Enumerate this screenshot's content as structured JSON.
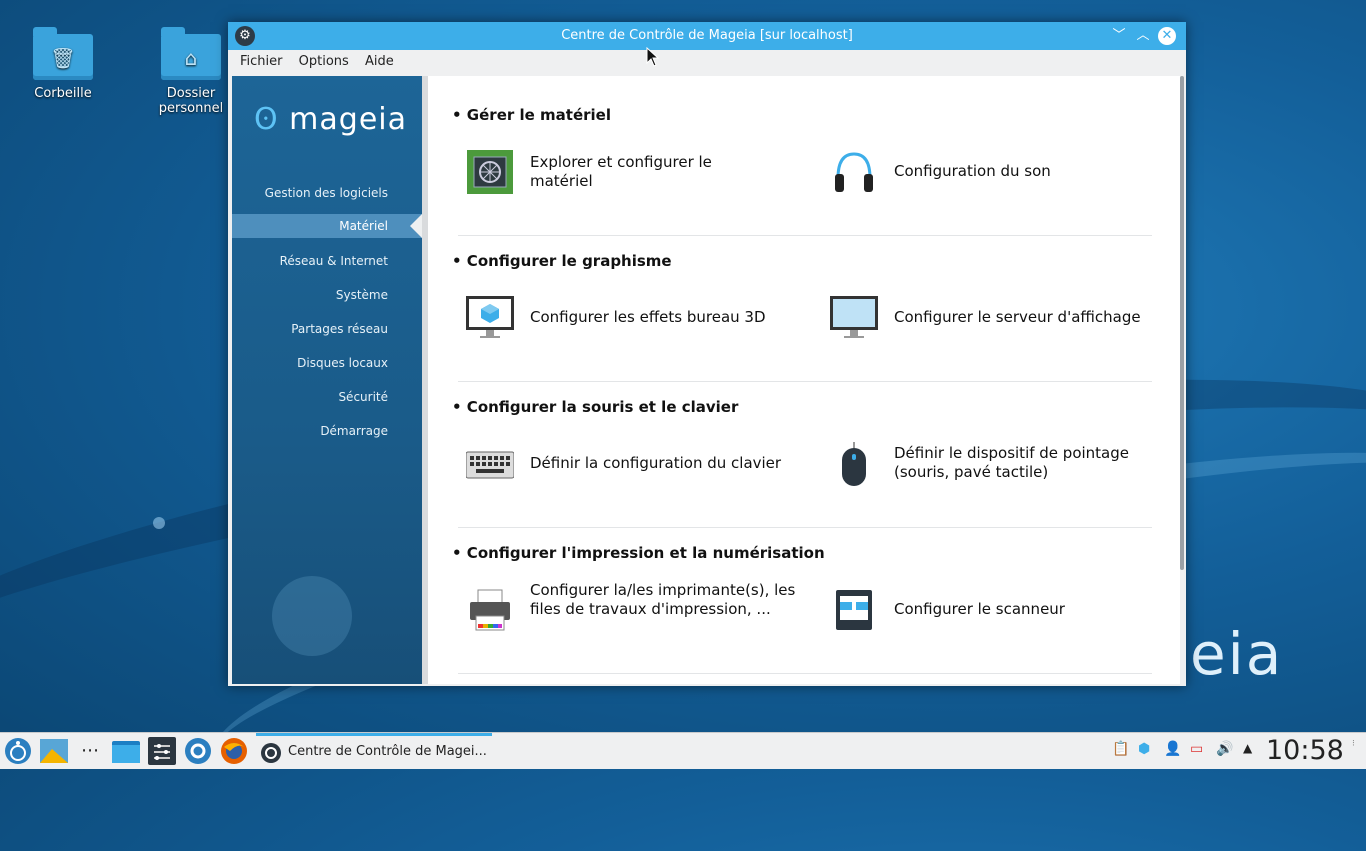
{
  "desktop": {
    "icons": [
      {
        "label": "Corbeille"
      },
      {
        "label": "Dossier personnel"
      }
    ],
    "wallpaper_logo": "eia"
  },
  "window": {
    "title": "Centre de Contrôle de Mageia [sur localhost]",
    "menu": [
      "Fichier",
      "Options",
      "Aide"
    ]
  },
  "sidebar": {
    "logo": "mageia",
    "items": [
      {
        "label": "Gestion des logiciels"
      },
      {
        "label": "Matériel"
      },
      {
        "label": "Réseau & Internet"
      },
      {
        "label": "Système"
      },
      {
        "label": "Partages réseau"
      },
      {
        "label": "Disques locaux"
      },
      {
        "label": "Sécurité"
      },
      {
        "label": "Démarrage"
      }
    ],
    "active": "Matériel"
  },
  "sections": [
    {
      "title": "• Gérer le matériel",
      "items": [
        {
          "label": "Explorer et configurer le matériel",
          "icon": "hardware-chip-icon"
        },
        {
          "label": "Configuration du son",
          "icon": "headphones-icon"
        }
      ]
    },
    {
      "title": "• Configurer le graphisme",
      "items": [
        {
          "label": "Configurer les effets bureau 3D",
          "icon": "monitor-3d-icon"
        },
        {
          "label": "Configurer le serveur d'affichage",
          "icon": "monitor-icon"
        }
      ]
    },
    {
      "title": "• Configurer la souris et le clavier",
      "items": [
        {
          "label": "Définir la configuration du clavier",
          "icon": "keyboard-icon"
        },
        {
          "label": "Définir le dispositif de pointage (souris, pavé tactile)",
          "icon": "mouse-icon"
        }
      ]
    },
    {
      "title": "• Configurer l'impression et la numérisation",
      "items": [
        {
          "label": "Configurer la/les imprimante(s), les files de travaux d'impression, ...",
          "icon": "printer-icon"
        },
        {
          "label": "Configurer le scanneur",
          "icon": "scanner-icon"
        }
      ]
    }
  ],
  "taskbar": {
    "active_task": "Centre de Contrôle de Magei...",
    "clock": "10:58"
  },
  "colors": {
    "accent": "#3daee9",
    "sidebar": "#1d6597"
  }
}
